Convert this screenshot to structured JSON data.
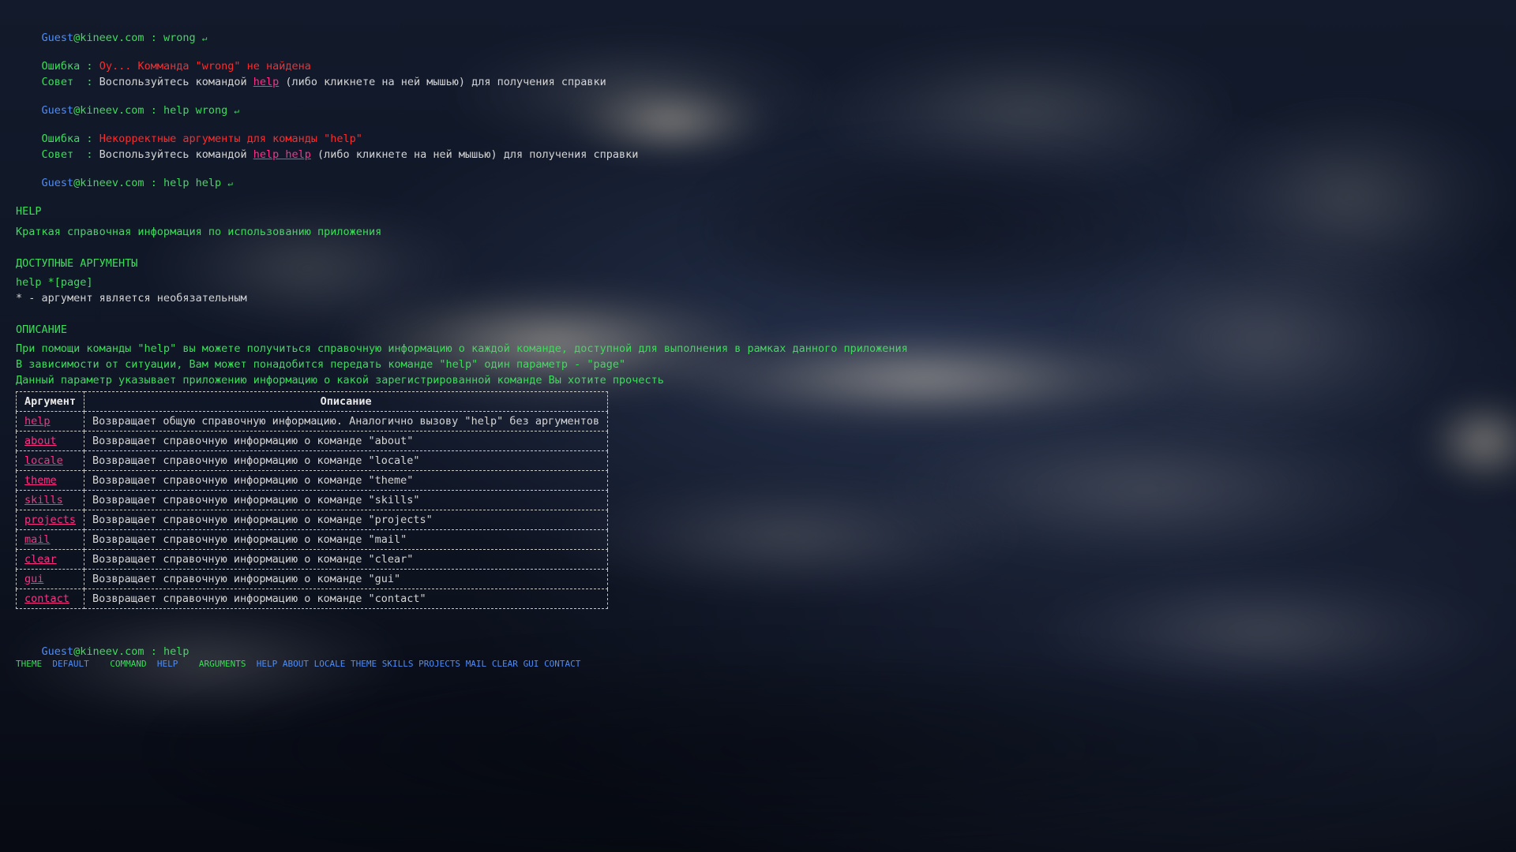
{
  "prompt": {
    "user": "Guest",
    "host": "@kineev.com",
    "separator": " : ",
    "enter_symbol": "↵"
  },
  "history": [
    {
      "command": "wrong",
      "error_label": "Ошибка",
      "error_text": "Оу... Комманда \"wrong\" не найдена",
      "tip_label": "Совет",
      "tip_prefix": "Воспользуйтесь командой",
      "tip_link": "help",
      "tip_suffix": "(либо кликнете на ней мышью) для получения справки"
    },
    {
      "command": "help wrong",
      "error_label": "Ошибка",
      "error_text": "Некорректные аргументы для команды \"help\"",
      "tip_label": "Совет",
      "tip_prefix": "Воспользуйтесь командой",
      "tip_link": "help help",
      "tip_suffix": "(либо кликнете на ней мышью) для получения справки"
    },
    {
      "command": "help help"
    }
  ],
  "help_output": {
    "title": "HELP",
    "summary": "Краткая справочная информация по использованию приложения",
    "args_title": "ДОСТУПНЫЕ АРГУМЕНТЫ",
    "usage": "help *[page]",
    "usage_note": "* - аргумент является необязательным",
    "desc_title": "ОПИСАНИЕ",
    "desc_lines": [
      "При помощи команды \"help\" вы можете получиться справочную информацию о каждой команде, доступной для выполнения в рамках данного приложения",
      "В зависимости от ситуации, Вам может понадобится передать команде \"help\" один параметр - \"page\"",
      "Данный параметр указывает приложению информацию о какой зарегистрированной команде Вы хотите прочесть"
    ],
    "table": {
      "headers": [
        "Аргумент",
        "Описание"
      ],
      "rows": [
        {
          "arg": "help",
          "desc": "Возвращает общую справочную информацию. Аналогично вызову \"help\" без аргументов"
        },
        {
          "arg": "about",
          "desc": "Возвращает справочную информацию о команде \"about\""
        },
        {
          "arg": "locale",
          "desc": "Возвращает справочную информацию о команде \"locale\""
        },
        {
          "arg": "theme",
          "desc": "Возвращает справочную информацию о команде \"theme\""
        },
        {
          "arg": "skills",
          "desc": "Возвращает справочную информацию о команде \"skills\""
        },
        {
          "arg": "projects",
          "desc": "Возвращает справочную информацию о команде \"projects\""
        },
        {
          "arg": "mail",
          "desc": "Возвращает справочную информацию о команде \"mail\""
        },
        {
          "arg": "clear",
          "desc": "Возвращает справочную информацию о команде \"clear\""
        },
        {
          "arg": "gui",
          "desc": "Возвращает справочную информацию о команде \"gui\""
        },
        {
          "arg": "contact",
          "desc": "Возвращает справочную информацию о команде \"contact\""
        }
      ]
    }
  },
  "current_input": "help",
  "hints": {
    "theme_label": "THEME",
    "theme_value": "DEFAULT",
    "command_label": "COMMAND",
    "command_value": "HELP",
    "arguments_label": "ARGUMENTS",
    "arguments": [
      "HELP",
      "ABOUT",
      "LOCALE",
      "THEME",
      "SKILLS",
      "PROJECTS",
      "MAIL",
      "CLEAR",
      "GUI",
      "CONTACT"
    ]
  },
  "colors": {
    "user": "#4f8cf5",
    "host": "#3ddc5a",
    "error": "#ff2a2a",
    "link": "#ff2f86",
    "text": "#d4d4d4",
    "background": "#0d1220"
  }
}
